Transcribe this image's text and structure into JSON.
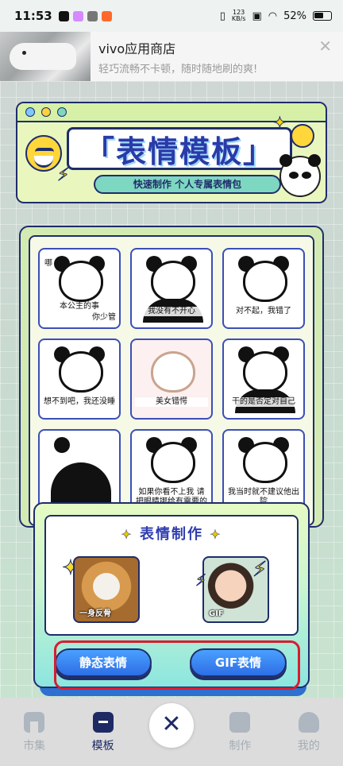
{
  "status_bar": {
    "time": "11:53",
    "netspeed_value": "123",
    "netspeed_unit": "KB/s",
    "battery": "52%"
  },
  "ad": {
    "title": "vivo应用商店",
    "subtitle": "轻巧流畅不卡顿，随时随地刷的爽!",
    "close_icon": "close-icon"
  },
  "header": {
    "title": "「表情模板」",
    "subtitle": "快速制作 个人专属表情包"
  },
  "templates": [
    {
      "caption_top": "哪",
      "caption": "本公主的事",
      "caption_extra": "你少管"
    },
    {
      "caption": "我没有不开心"
    },
    {
      "caption": "对不起，我错了"
    },
    {
      "caption": "想不到吧，我还没睡"
    },
    {
      "caption": "美女错愕"
    },
    {
      "caption": "干的是否定对自己"
    },
    {
      "caption": ""
    },
    {
      "caption": "如果你看不上我 请把眼睛挪给有需要的人"
    },
    {
      "caption": "我当时就不建议他出院"
    }
  ],
  "make": {
    "title": "表情制作",
    "static_thumb_label": "一身反骨",
    "gif_thumb_label": "GIF",
    "static_button": "静态表情",
    "gif_button": "GIF表情"
  },
  "nav": {
    "items": [
      {
        "label": "市集",
        "icon": "home-icon"
      },
      {
        "label": "模板",
        "icon": "template-icon"
      },
      {
        "label": "制作",
        "icon": "edit-icon"
      },
      {
        "label": "我的",
        "icon": "user-icon"
      }
    ],
    "active": "模板",
    "close_glyph": "✕"
  },
  "colors": {
    "accent_blue": "#2d6ee6",
    "navy": "#1f2d6b",
    "highlight_red": "#d91c2f"
  }
}
